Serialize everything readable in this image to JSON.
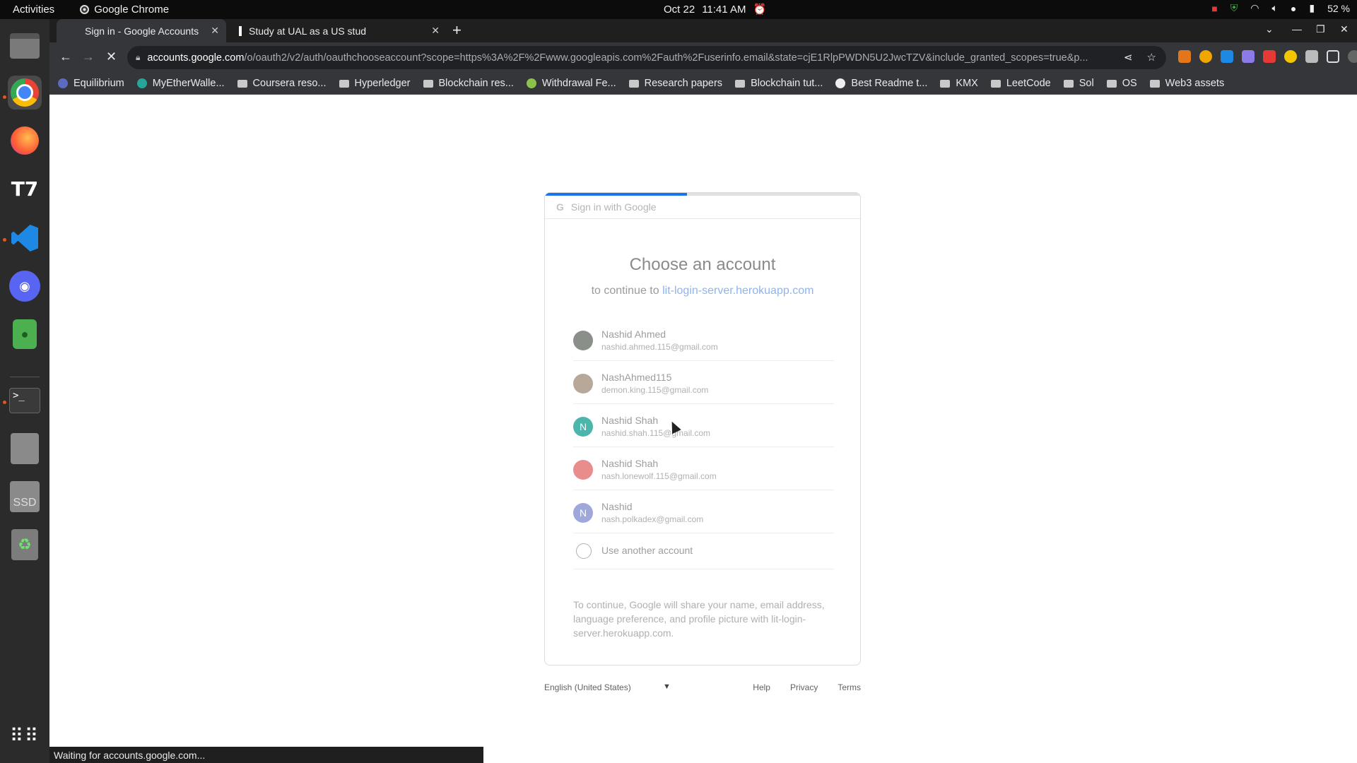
{
  "topbar": {
    "activities": "Activities",
    "app_name": "Google Chrome",
    "date": "Oct 22",
    "time": "11:41 AM",
    "battery": "52 %"
  },
  "dock": {
    "items": [
      "files",
      "chrome",
      "firefox",
      "tradingview",
      "vscode",
      "discord",
      "vpn",
      "terminal",
      "text-editor",
      "ssd-drive",
      "trash",
      "show-apps"
    ],
    "ssd_label": "SSD"
  },
  "tabs": [
    {
      "title": "Sign in - Google Accounts",
      "active": true
    },
    {
      "title": "Study at UAL as a US stud",
      "active": false
    }
  ],
  "address_bar": {
    "host": "accounts.google.com",
    "path": "/o/oauth2/v2/auth/oauthchooseaccount?scope=https%3A%2F%2Fwww.googleapis.com%2Fauth%2Fuserinfo.email&state=cjE1RlpPWDN5U2JwcTZV&include_granted_scopes=true&p..."
  },
  "bookmarks": [
    "Equilibrium",
    "MyEtherWalle...",
    "Coursera reso...",
    "Hyperledger",
    "Blockchain res...",
    "Withdrawal Fe...",
    "Research papers",
    "Blockchain tut...",
    "Best Readme t...",
    "KMX",
    "LeetCode",
    "Sol",
    "OS",
    "Web3 assets"
  ],
  "signin": {
    "header": "Sign in with Google",
    "progress": 0.45,
    "title": "Choose an account",
    "subtitle_prefix": "to continue to",
    "app_domain": "lit-login-server.herokuapp.com",
    "accounts": [
      {
        "name": "Nashid Ahmed",
        "email": "nashid.ahmed.115@gmail.com",
        "initial": "",
        "color": "#8a8f8a"
      },
      {
        "name": "NashAhmed115",
        "email": "demon.king.115@gmail.com",
        "initial": "",
        "color": "#b8a89a"
      },
      {
        "name": "Nashid Shah",
        "email": "nashid.shah.115@gmail.com",
        "initial": "N",
        "color": "#4db6ac"
      },
      {
        "name": "Nashid Shah",
        "email": "nash.lonewolf.115@gmail.com",
        "initial": "",
        "color": "#e88c8c"
      },
      {
        "name": "Nashid",
        "email": "nash.polkadex@gmail.com",
        "initial": "N",
        "color": "#9fa8da"
      }
    ],
    "use_another": "Use another account",
    "notice": "To continue, Google will share your name, email address, language preference, and profile picture with lit-login-server.herokuapp.com."
  },
  "footer": {
    "language": "English (United States)",
    "links": [
      "Help",
      "Privacy",
      "Terms"
    ]
  },
  "status_bar": "Waiting for accounts.google.com..."
}
